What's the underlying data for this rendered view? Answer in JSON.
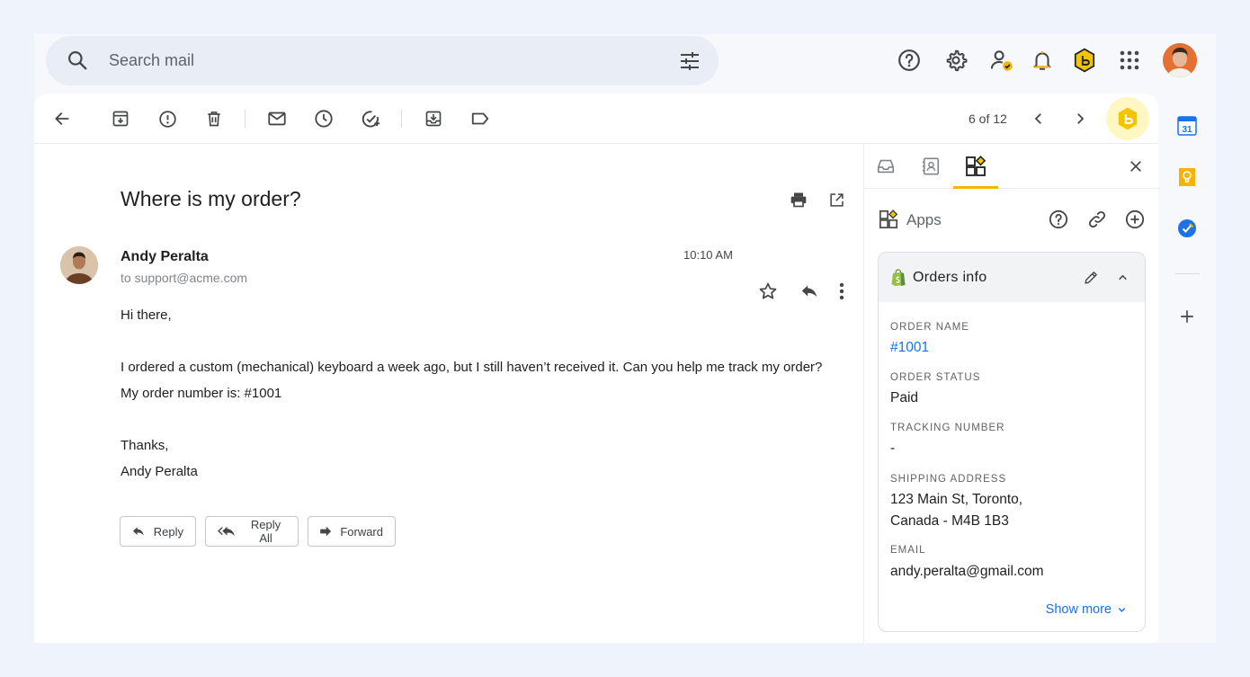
{
  "search": {
    "placeholder": "Search mail"
  },
  "toolbar": {
    "pager": "6 of 12"
  },
  "email": {
    "subject": "Where is my order?",
    "sender_name": "Andy Peralta",
    "sender_to": "to support@acme.com",
    "time": "10:10 AM",
    "body": {
      "greeting": "Hi there,",
      "line1": "I ordered a custom (mechanical) keyboard a week ago, but I still haven’t received it. Can you help me track my order?",
      "line2": "My order number is: #1001",
      "closing": "Thanks,",
      "signature": "Andy Peralta"
    },
    "actions": {
      "reply": "Reply",
      "reply_all": "Reply All",
      "forward": "Forward"
    }
  },
  "panel": {
    "apps_label": "Apps",
    "card_title": "Orders info",
    "fields": {
      "order_name_label": "ORDER NAME",
      "order_name_value": "#1001",
      "order_status_label": "ORDER STATUS",
      "order_status_value": "Paid",
      "tracking_label": "TRACKING NUMBER",
      "tracking_value": "-",
      "shipping_label": "SHIPPING ADDRESS",
      "shipping_line1": "123 Main St, Toronto,",
      "shipping_line2": "Canada - M4B 1B3",
      "email_label": "EMAIL",
      "email_value": "andy.peralta@gmail.com"
    },
    "show_more": "Show more"
  },
  "rail": {
    "calendar_day": "31"
  },
  "colors": {
    "accent": "#1a73e8",
    "brand_yellow": "#f2b600",
    "hb_bg": "#fef7c3"
  }
}
